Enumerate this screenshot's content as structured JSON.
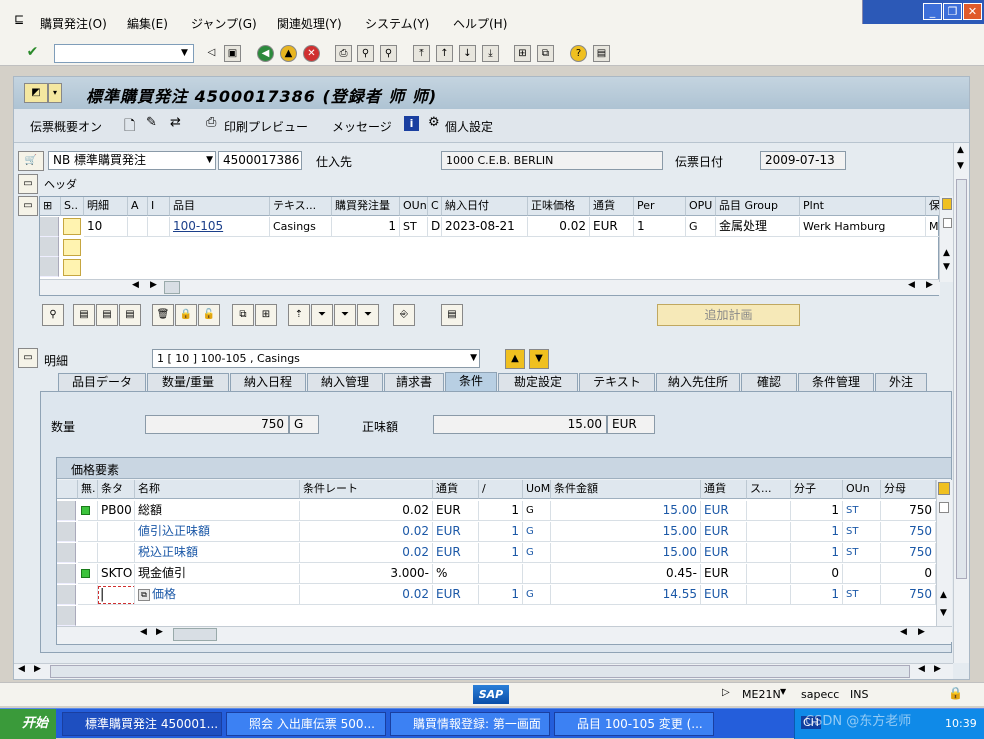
{
  "menu": {
    "items": [
      "購買発注(O)",
      "編集(E)",
      "ジャンプ(G)",
      "関連処理(Y)",
      "システム(Y)",
      "ヘルプ(H)"
    ]
  },
  "window_controls": {
    "minimize": "_",
    "restore": "❐",
    "close": "✕"
  },
  "title": "標準購買発注 4500017386 (登録者 师 师)",
  "app_toolbar": {
    "overview_label": "伝票概要オン",
    "print_preview_label": "印刷プレビュー",
    "messages_label": "メッセージ",
    "personal_settings_label": "個人設定"
  },
  "header": {
    "doc_type": "NB 標準購買発注",
    "po_number": "4500017386",
    "vendor_label": "仕入先",
    "vendor_value": "1000 C.E.B. BERLIN",
    "doc_date_label": "伝票日付",
    "doc_date_value": "2009-07-13",
    "header_label": "ヘッダ"
  },
  "items_grid": {
    "columns": [
      "S..",
      "明細",
      "A",
      "I",
      "品目",
      "テキス...",
      "購買発注量",
      "OUn",
      "C",
      "納入日付",
      "正味価格",
      "通貨",
      "Per",
      "OPU",
      "品目 Group",
      "Plnt",
      "保"
    ],
    "rows": [
      {
        "item": "10",
        "material": "100-105",
        "text": "Casings",
        "qty": "1",
        "oun": "ST",
        "c": "D",
        "date": "2023-08-21",
        "price": "0.02",
        "curr": "EUR",
        "per": "1",
        "opu": "G",
        "group": "金属处理",
        "plant": "Werk Hamburg",
        "store": "Ma"
      }
    ]
  },
  "add_plan_label": "追加計画",
  "detail": {
    "label": "明細",
    "selector_value": "1 [ 10 ] 100-105 , Casings"
  },
  "tabs": [
    "品目データ",
    "数量/重量",
    "納入日程",
    "納入管理",
    "請求書",
    "条件",
    "勘定設定",
    "テキスト",
    "納入先住所",
    "確認",
    "条件管理",
    "外注"
  ],
  "active_tab": "条件",
  "conditions": {
    "qty_label": "数量",
    "qty_value": "750",
    "qty_unit": "G",
    "net_label": "正味額",
    "net_value": "15.00",
    "net_curr": "EUR",
    "pricing_title": "価格要素",
    "columns": [
      "無.",
      "条タ",
      "名称",
      "条件レート",
      "通貨",
      "/",
      "UoM",
      "条件金額",
      "通貨",
      "ス...",
      "分子",
      "OUn",
      "分母"
    ],
    "rows": [
      {
        "status": true,
        "ctype": "PB00",
        "name": "総額",
        "rate": "0.02",
        "curr": "EUR",
        "per": "1",
        "uom": "G",
        "amount": "15.00",
        "curr2": "EUR",
        "num": "1",
        "oun": "ST",
        "den": "750",
        "blue": false
      },
      {
        "status": false,
        "ctype": "",
        "name": "値引込正味額",
        "rate": "0.02",
        "curr": "EUR",
        "per": "1",
        "uom": "G",
        "amount": "15.00",
        "curr2": "EUR",
        "num": "1",
        "oun": "ST",
        "den": "750",
        "blue": true
      },
      {
        "status": false,
        "ctype": "",
        "name": "税込正味額",
        "rate": "0.02",
        "curr": "EUR",
        "per": "1",
        "uom": "G",
        "amount": "15.00",
        "curr2": "EUR",
        "num": "1",
        "oun": "ST",
        "den": "750",
        "blue": true
      },
      {
        "status": true,
        "ctype": "SKTO",
        "name": "現金値引",
        "rate": "3.000-",
        "curr": "%",
        "per": "",
        "uom": "",
        "amount": "0.45-",
        "curr2": "EUR",
        "num": "0",
        "oun": "",
        "den": "0",
        "blue": false
      },
      {
        "status": false,
        "ctype": "",
        "name": "価格",
        "rate": "0.02",
        "curr": "EUR",
        "per": "1",
        "uom": "G",
        "amount": "14.55",
        "curr2": "EUR",
        "num": "1",
        "oun": "ST",
        "den": "750",
        "blue": true
      }
    ]
  },
  "status": {
    "tcode": "ME21N",
    "server": "sapecc",
    "mode": "INS",
    "sap_logo": "SAP"
  },
  "taskbar": {
    "start": "开始",
    "tasks": [
      "標準購買発注 450001...",
      "照会 入出庫伝票 500...",
      "購買情報登録: 第一画面",
      "品目 100-105 変更 (..."
    ],
    "tray_lang": "CH",
    "watermark": "CSDN @东方老师",
    "clock": "10:39"
  }
}
